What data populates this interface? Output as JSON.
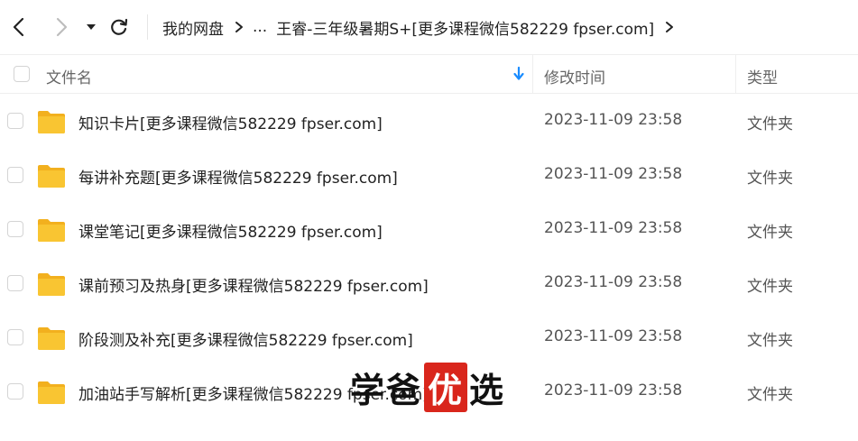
{
  "toolbar": {
    "back_icon": "chevron-left-icon",
    "forward_icon": "chevron-right-icon",
    "history_icon": "dropdown-triangle-icon",
    "refresh_icon": "refresh-icon"
  },
  "breadcrumb": {
    "root": "我的网盘",
    "ellipsis": "...",
    "current": "王睿-三年级暑期S+[更多课程微信582229 fpser.com]"
  },
  "table": {
    "headers": {
      "name": "文件名",
      "time": "修改时间",
      "type": "类型"
    },
    "sort_icon": "sort-down-arrow-icon",
    "rows": [
      {
        "name": "知识卡片[更多课程微信582229 fpser.com]",
        "time": "2023-11-09 23:58",
        "type": "文件夹"
      },
      {
        "name": "每讲补充题[更多课程微信582229 fpser.com]",
        "time": "2023-11-09 23:58",
        "type": "文件夹"
      },
      {
        "name": "课堂笔记[更多课程微信582229 fpser.com]",
        "time": "2023-11-09 23:58",
        "type": "文件夹"
      },
      {
        "name": "课前预习及热身[更多课程微信582229 fpser.com]",
        "time": "2023-11-09 23:58",
        "type": "文件夹"
      },
      {
        "name": "阶段测及补充[更多课程微信582229 fpser.com]",
        "time": "2023-11-09 23:58",
        "type": "文件夹"
      },
      {
        "name": "加油站手写解析[更多课程微信582229 fpser.com]",
        "time": "2023-11-09 23:58",
        "type": "文件夹"
      }
    ]
  },
  "watermark": {
    "part1": "学爸",
    "part2": "优",
    "part3": "选"
  },
  "colors": {
    "folder": "#f9c532",
    "folder_dark": "#f2b01e",
    "sort_arrow": "#1a8cff",
    "watermark_red": "#d9261c"
  }
}
